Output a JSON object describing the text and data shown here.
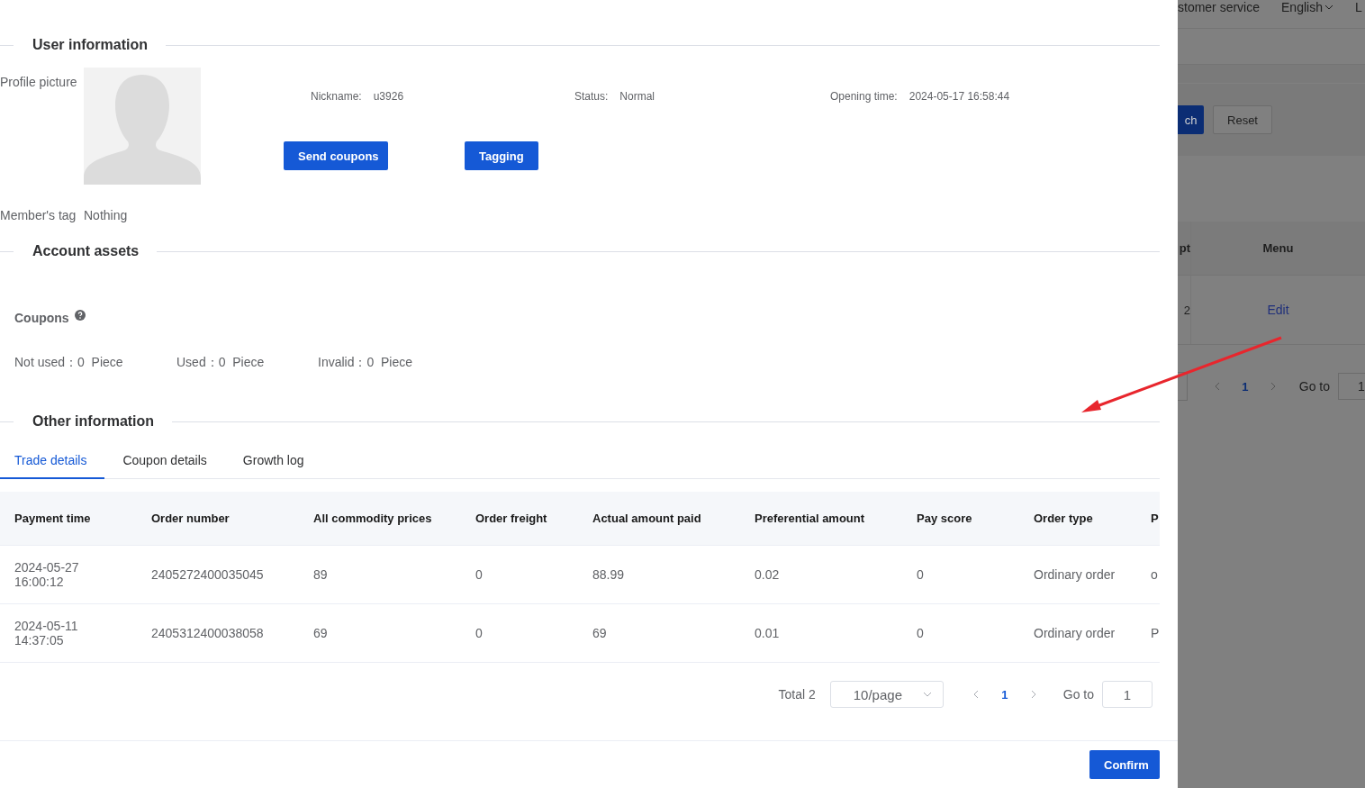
{
  "drawer": {
    "user_information": {
      "title": "User information",
      "profile_picture_label": "Profile picture",
      "fields": [
        {
          "label": "Nickname:",
          "value": "u3926"
        },
        {
          "label": "Status:",
          "value": "Normal"
        },
        {
          "label": "Opening time:",
          "value": "2024-05-17 16:58:44"
        }
      ],
      "buttons": [
        "Send coupons",
        "Tagging"
      ],
      "member_tag": {
        "label": "Member's tag",
        "value": "Nothing"
      }
    },
    "account_assets": {
      "title": "Account assets",
      "coupons_label": "Coupons",
      "counts": [
        {
          "label": "Not used：",
          "value": "0",
          "unit": "Piece"
        },
        {
          "label": "Used：",
          "value": "0",
          "unit": "Piece"
        },
        {
          "label": "Invalid：",
          "value": "0",
          "unit": "Piece"
        }
      ]
    },
    "other_information": {
      "title": "Other information",
      "tabs": [
        {
          "label": "Trade details",
          "selected": true
        },
        {
          "label": "Coupon details",
          "selected": false
        },
        {
          "label": "Growth log",
          "selected": false
        }
      ],
      "table": {
        "columns": [
          "Payment time",
          "Order number",
          "All commodity prices",
          "Order freight",
          "Actual amount paid",
          "Preferential amount",
          "Pay score",
          "Order type",
          "P"
        ],
        "rows": [
          [
            "2024-05-27 16:00:12",
            "2405272400035045",
            "89",
            "0",
            "88.99",
            "0.02",
            "0",
            "Ordinary order",
            "o"
          ],
          [
            "2024-05-11 14:37:05",
            "2405312400038058",
            "69",
            "0",
            "69",
            "0.01",
            "0",
            "Ordinary order",
            "P"
          ]
        ]
      },
      "pagination": {
        "total": "Total 2",
        "page_size": "10/page",
        "pages": [
          {
            "label": "1",
            "selected": true
          }
        ],
        "goto_label": "Go to",
        "goto_value": "1"
      }
    },
    "confirm_button": "Confirm"
  },
  "background_page": {
    "header": [
      "stomer service",
      "English",
      "L"
    ],
    "search_button": "ch",
    "reset_button": "Reset",
    "table": {
      "columns": [
        "pt",
        "Menu"
      ],
      "rows": [
        [
          "2",
          "Edit"
        ]
      ]
    },
    "pagination": {
      "pages": [
        {
          "label": "1",
          "selected": true
        }
      ],
      "goto_label": "Go to",
      "goto_value": "1"
    }
  }
}
